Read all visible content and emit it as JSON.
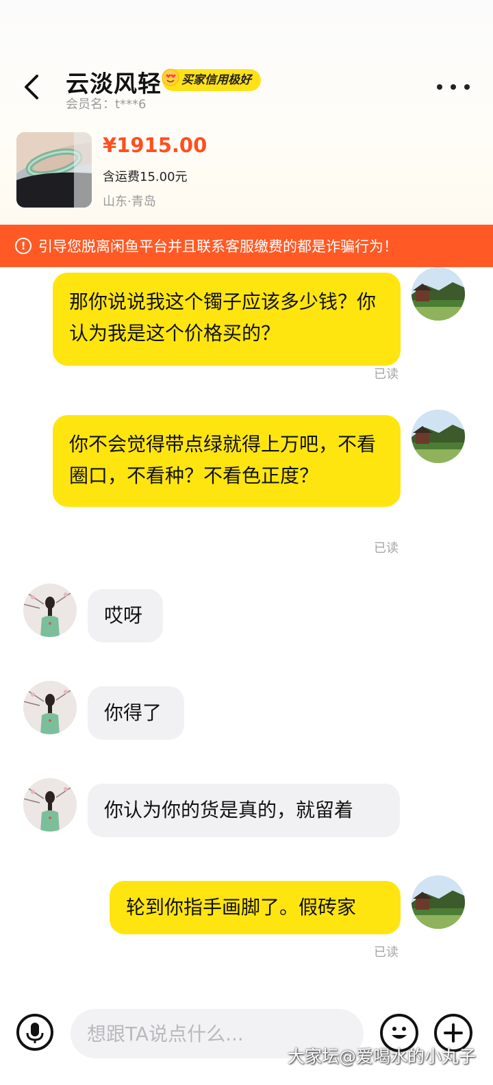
{
  "header": {
    "title": "云淡风轻",
    "badge": "买家信用极好",
    "member": "会员名：t***6"
  },
  "product": {
    "price": "¥1915.00",
    "shipping": "含运费15.00元",
    "location": "山东·青岛"
  },
  "warning": {
    "text": "引导您脱离闲鱼平台并且联系客服缴费的都是诈骗行为！"
  },
  "messages": [
    {
      "from": "me",
      "text": "那你说说我这个镯子应该多少钱？你认为我是这个价格买的？",
      "status": "已读"
    },
    {
      "from": "me",
      "text": "你不会觉得带点绿就得上万吧，不看圈口，不看种？不看色正度？",
      "status": "已读"
    },
    {
      "from": "them",
      "text": "哎呀"
    },
    {
      "from": "them",
      "text": "你得了"
    },
    {
      "from": "them",
      "text": "你认为你的货是真的，就留着"
    },
    {
      "from": "me",
      "text": "轮到你指手画脚了。假砖家",
      "status": "已读"
    }
  ],
  "input": {
    "placeholder": "想跟TA说点什么..."
  },
  "icons": {
    "back": "back-icon",
    "more": "more-icon",
    "warning": "warning-icon",
    "voice": "microphone-icon",
    "emoji": "emoji-icon",
    "plus": "plus-icon"
  },
  "colors": {
    "accent_yellow": "#ffe50f",
    "price_orange": "#ff4e1f",
    "warning_bg": "#ff5a26"
  },
  "watermark": "大家坛@爱喝水的小丸子"
}
